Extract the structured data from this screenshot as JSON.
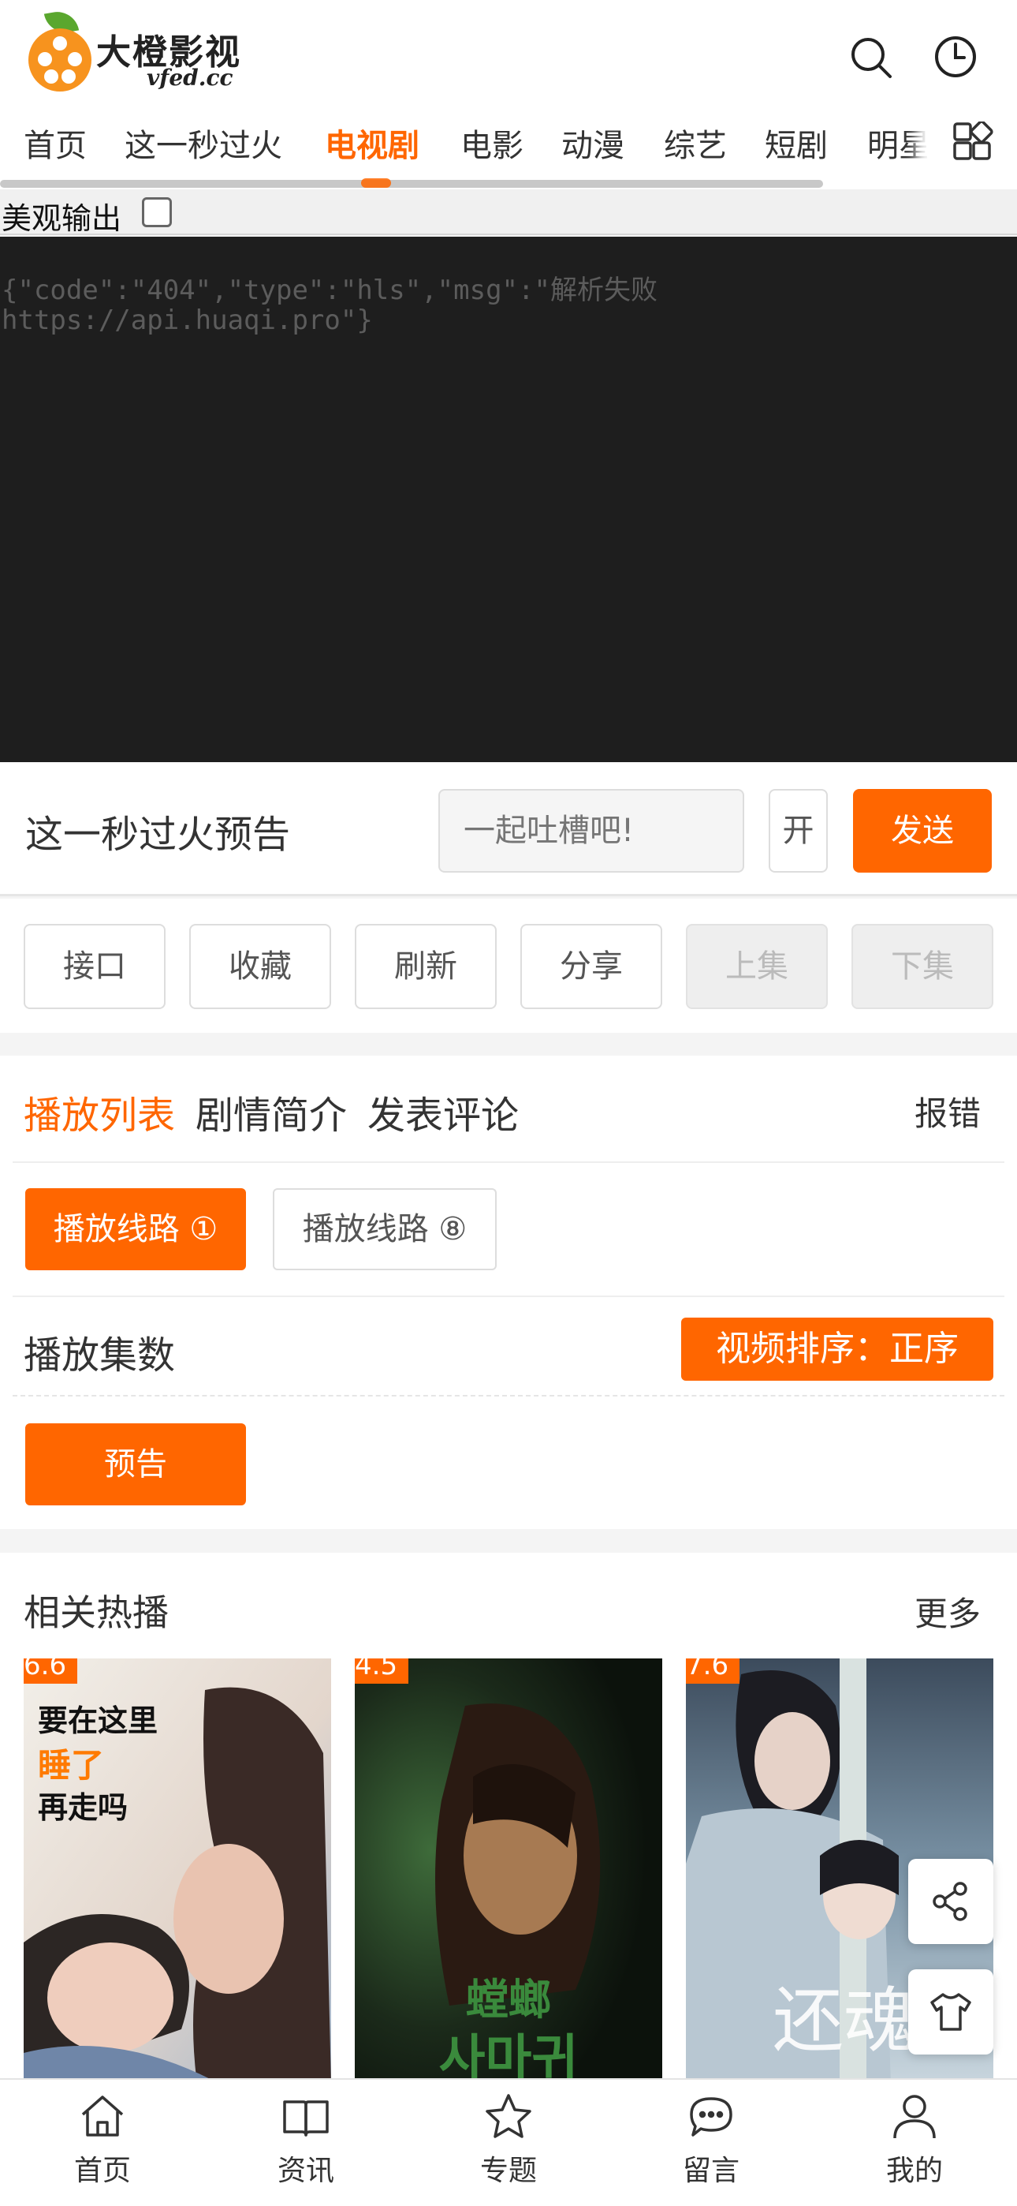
{
  "header": {
    "logo_title": "大橙影视",
    "logo_sub": "vfed.cc",
    "search_icon": "search-icon",
    "history_icon": "clock-icon"
  },
  "nav": {
    "items": [
      "首页",
      "这一秒过火",
      "电视剧",
      "电影",
      "动漫",
      "综艺",
      "短剧",
      "明星"
    ],
    "active": "电视剧",
    "grid_icon": "grid-icon"
  },
  "player": {
    "pretty_label": "美观输出",
    "json_line1": "{\"code\":\"404\",\"type\":\"hls\",\"msg\":\"解析失败",
    "json_line2": "https://api.huaqi.pro\"}"
  },
  "danmaku": {
    "title": "这一秒过火预告",
    "placeholder": "一起吐槽吧!",
    "toggle_label": "开",
    "send_label": "发送"
  },
  "controls": {
    "interface": "接口",
    "favorite": "收藏",
    "refresh": "刷新",
    "share": "分享",
    "prev": "上集",
    "next": "下集"
  },
  "tabs": {
    "playlist": "播放列表",
    "synopsis": "剧情简介",
    "comment": "发表评论",
    "report": "报错"
  },
  "routes": {
    "route1": "播放线路 ①",
    "route2": "播放线路 ⑧"
  },
  "episodes": {
    "title": "播放集数",
    "sort_label": "视频排序：正序",
    "items": [
      "预告"
    ]
  },
  "related": {
    "title": "相关热播",
    "more": "更多",
    "items": [
      {
        "score": "6.6",
        "poster_text": [
          "要在这里",
          "睡了",
          "再走吗"
        ]
      },
      {
        "score": "4.5",
        "poster_text": [
          "螳螂",
          "사마귀"
        ]
      },
      {
        "score": "7.6",
        "poster_text": [
          "还魂"
        ]
      }
    ]
  },
  "floating": {
    "share_icon": "share-icon",
    "skin_icon": "tshirt-icon"
  },
  "bottom_nav": [
    {
      "label": "首页",
      "icon": "home-icon"
    },
    {
      "label": "资讯",
      "icon": "book-icon"
    },
    {
      "label": "专题",
      "icon": "star-icon"
    },
    {
      "label": "留言",
      "icon": "chat-icon"
    },
    {
      "label": "我的",
      "icon": "user-icon"
    }
  ],
  "colors": {
    "accent": "#ff6600",
    "player_bg": "#1e1e1e",
    "logo_orange": "#f7931e",
    "logo_leaf": "#5aa72e"
  }
}
